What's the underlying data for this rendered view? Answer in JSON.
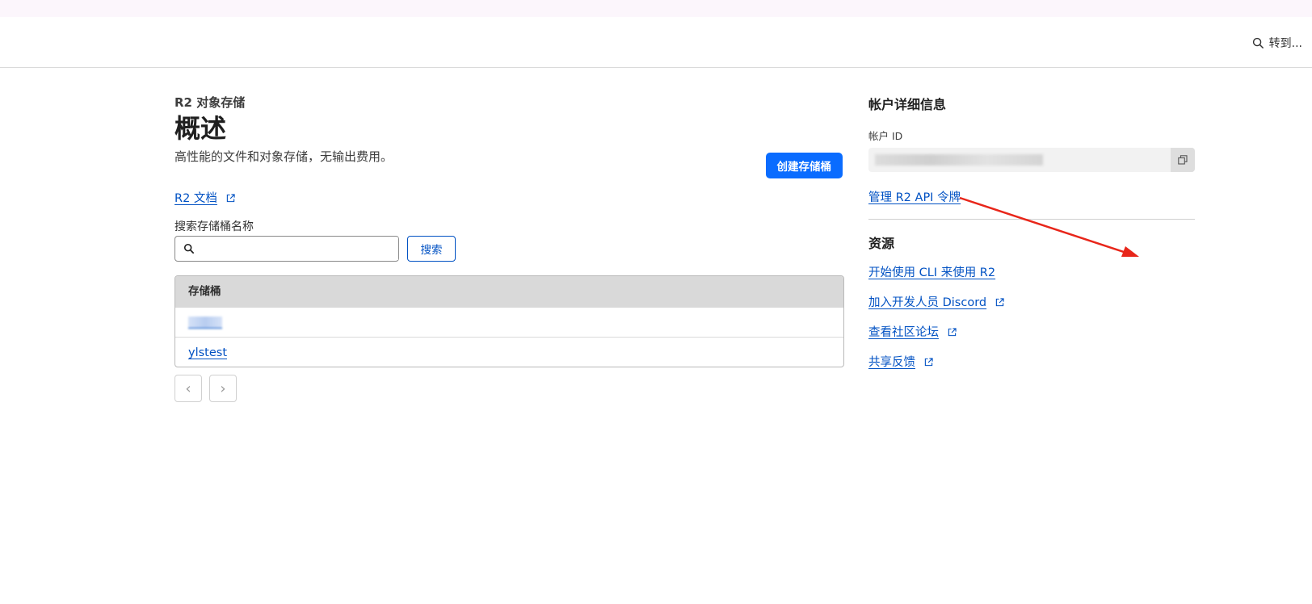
{
  "header": {
    "goto_label": "转到..."
  },
  "main": {
    "breadcrumb": "R2 对象存储",
    "title": "概述",
    "subtitle": "高性能的文件和对象存储，无输出费用。",
    "create_button": "创建存储桶",
    "docs_link": "R2 文档",
    "search_label": "搜索存储桶名称",
    "search_placeholder": "",
    "search_button": "搜索",
    "table": {
      "header": "存储桶",
      "rows": [
        {
          "name": ""
        },
        {
          "name": "ylstest"
        }
      ]
    },
    "pager": {
      "prev": "‹",
      "next": "›"
    }
  },
  "sidebar": {
    "account_title": "帐户详细信息",
    "account_id_label": "帐户 ID",
    "api_link": "管理 R2 API 令牌",
    "resources_title": "资源",
    "resources": [
      {
        "label": "开始使用 CLI 来使用 R2",
        "external": false
      },
      {
        "label": "加入开发人员 Discord",
        "external": true
      },
      {
        "label": "查看社区论坛",
        "external": true
      },
      {
        "label": "共享反馈",
        "external": true
      }
    ]
  },
  "colors": {
    "accent": "#0a6cff",
    "link": "#0051c3",
    "annotation_arrow": "#e8261a"
  }
}
